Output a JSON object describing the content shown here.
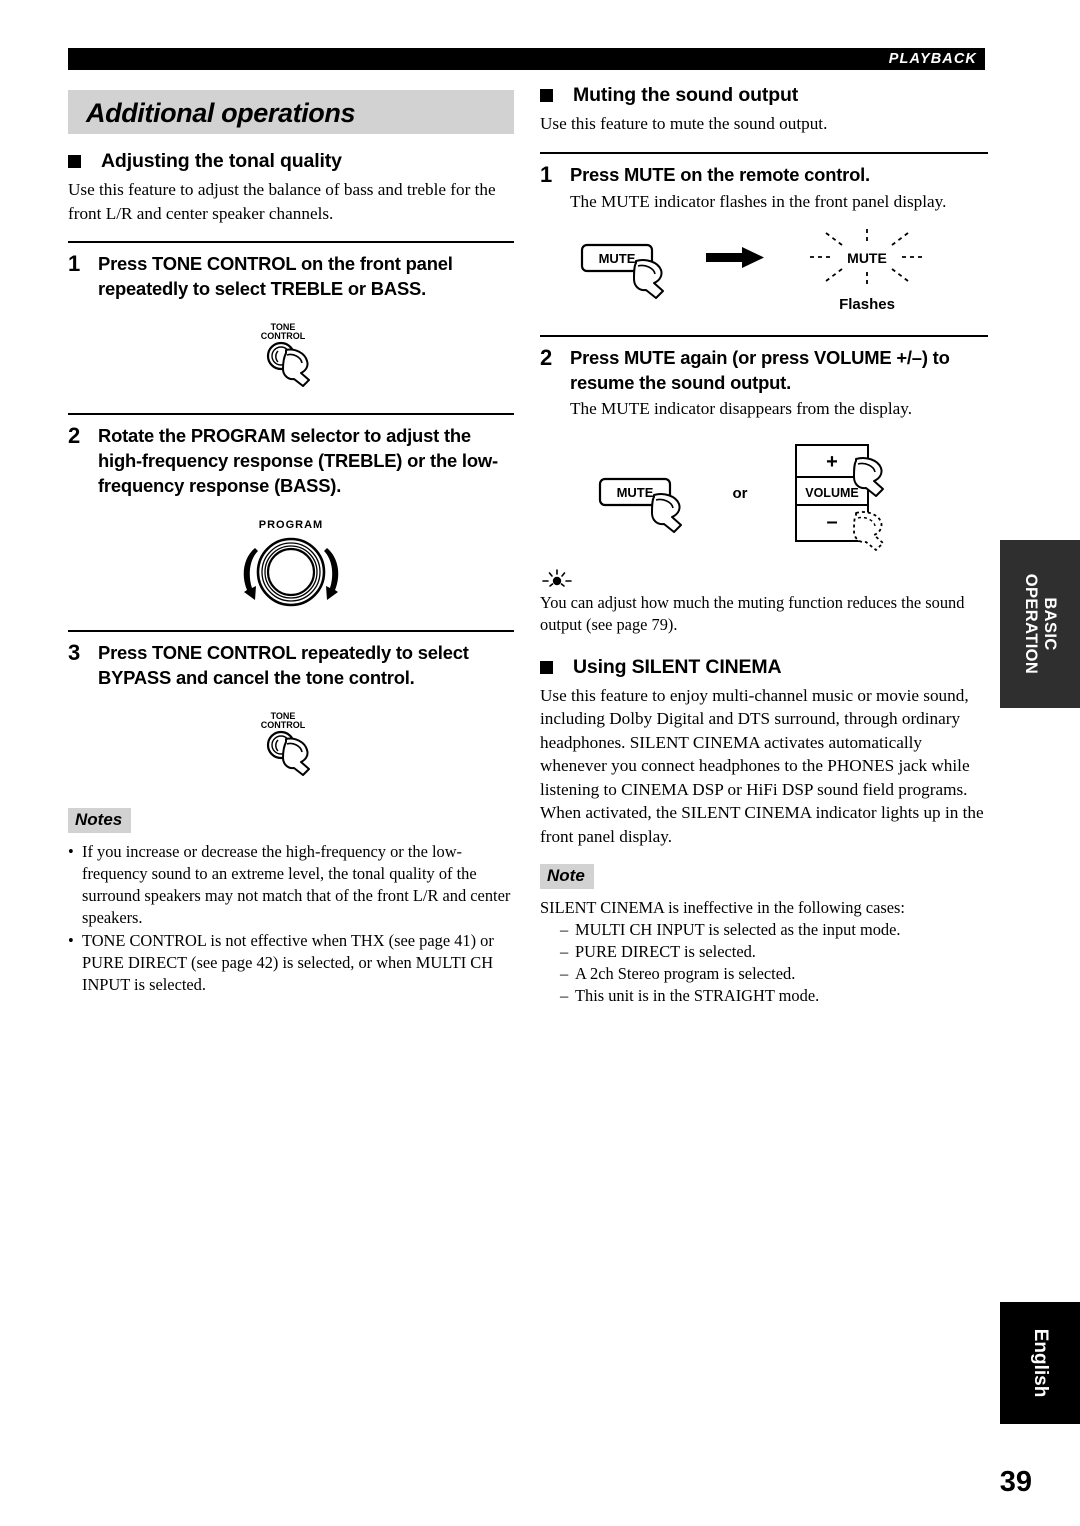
{
  "running_head": {
    "label": "PLAYBACK"
  },
  "chapter": {
    "title": "Additional operations"
  },
  "page_number": "39",
  "thumb_tabs": {
    "basic_operation_line1": "BASIC",
    "basic_operation_line2": "OPERATION",
    "english": "English"
  },
  "left_column": {
    "section": {
      "title": "Adjusting the tonal quality",
      "intro": "Use this feature to adjust the balance of bass and treble for the front L/R and center speaker channels."
    },
    "steps": [
      {
        "num": "1",
        "text": "Press TONE CONTROL on the front panel repeatedly to select TREBLE or BASS.",
        "illustration": "tone-control-knob-press",
        "illustration_labels": [
          "TONE",
          "CONTROL"
        ]
      },
      {
        "num": "2",
        "text": "Rotate the PROGRAM selector to adjust the high-frequency response (TREBLE) or the low-frequency response (BASS).",
        "illustration": "program-selector-dial",
        "illustration_labels": [
          "PROGRAM"
        ]
      },
      {
        "num": "3",
        "text": "Press TONE CONTROL repeatedly to select BYPASS and cancel the tone control.",
        "illustration": "tone-control-knob-press",
        "illustration_labels": [
          "TONE",
          "CONTROL"
        ]
      }
    ],
    "notes": {
      "badge": "Notes",
      "items": [
        "If you increase or decrease the high-frequency or the low-frequency sound to an extreme level, the tonal quality of the surround speakers may not match that of the front L/R and center speakers.",
        "TONE CONTROL is not effective when THX (see page 41) or PURE DIRECT (see page 42) is selected, or when MULTI CH INPUT is selected."
      ]
    }
  },
  "right_column": {
    "muting_section": {
      "title": "Muting the sound output",
      "intro": "Use this feature to mute the sound output.",
      "steps": [
        {
          "num": "1",
          "text": "Press MUTE on the remote control.",
          "sub": "The MUTE indicator flashes in the front panel display.",
          "illustration": "mute-button-press-to-flashing-indicator",
          "illustration_labels": {
            "button": "MUTE",
            "indicator": "MUTE",
            "caption": "Flashes"
          }
        },
        {
          "num": "2",
          "text": "Press MUTE again (or press VOLUME +/–) to resume the sound output.",
          "sub": "The MUTE indicator disappears from the display.",
          "illustration": "mute-button-or-volume-rocker",
          "illustration_labels": {
            "button": "MUTE",
            "connector": "or",
            "volume_plus": "+",
            "volume": "VOLUME",
            "volume_minus": "–"
          }
        }
      ],
      "tip": {
        "icon": "tip-bulb-icon",
        "text": "You can adjust how much the muting function reduces the sound output (see page 79)."
      }
    },
    "silent_cinema_section": {
      "title": "Using SILENT CINEMA",
      "body": "Use this feature to enjoy multi-channel music or movie sound, including Dolby Digital and DTS surround, through ordinary headphones. SILENT CINEMA activates automatically whenever you connect headphones to the PHONES jack while listening to CINEMA DSP or HiFi DSP sound field programs. When activated, the SILENT CINEMA indicator lights up in the front panel display.",
      "note": {
        "badge": "Note",
        "intro": "SILENT CINEMA is ineffective in the following cases:",
        "items": [
          "MULTI CH INPUT is selected as the input mode.",
          "PURE DIRECT is selected.",
          "A 2ch Stereo program is selected.",
          "This unit is in the STRAIGHT mode."
        ]
      }
    }
  },
  "colors": {
    "band_gray": "#d2d2d2",
    "tab_dark": "#2f2f2f",
    "black": "#000000"
  }
}
